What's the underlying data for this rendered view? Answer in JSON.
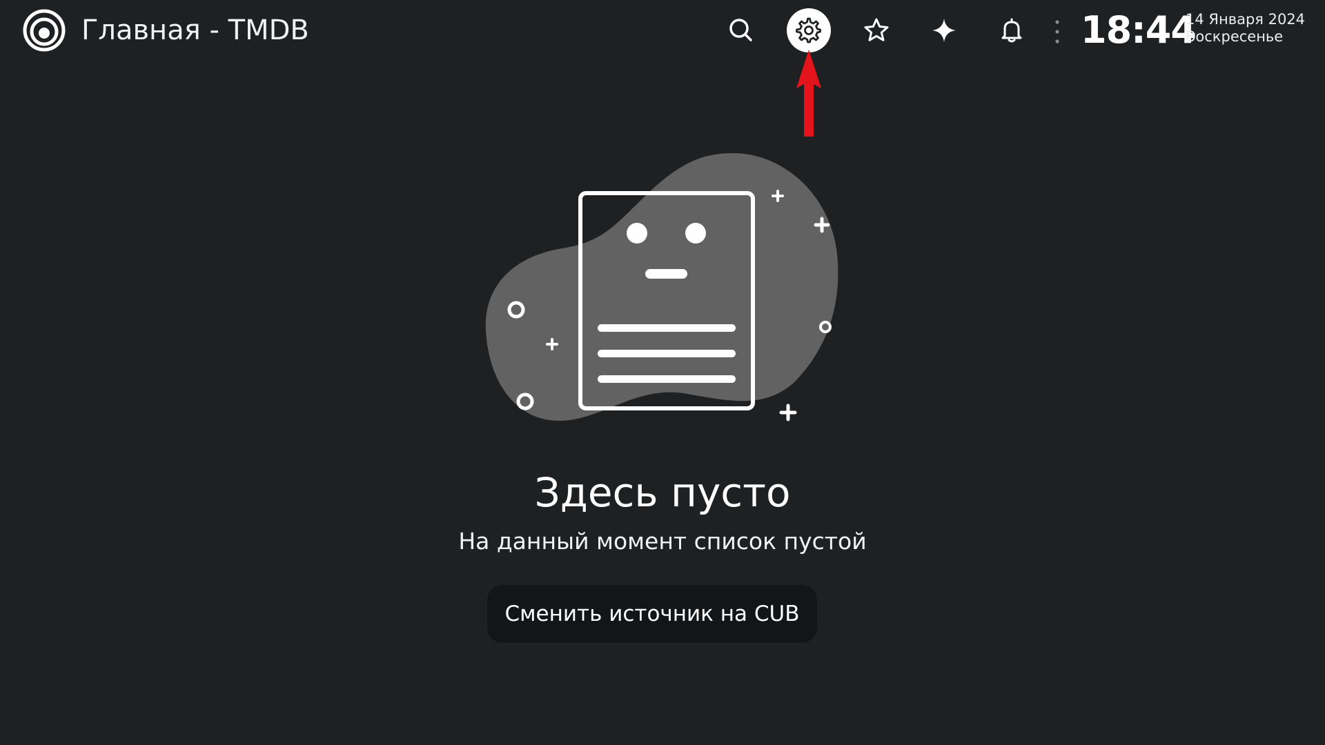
{
  "header": {
    "title": "Главная - TMDB",
    "icons": {
      "logo": "app-logo",
      "search": "search-icon",
      "settings": "gear-icon",
      "bookmarks": "star-icon",
      "feed": "sparkle-icon",
      "notifications": "bell-icon",
      "more": "dots-vertical-icon"
    },
    "time": "18:44",
    "date": "14 Января 2024",
    "weekday": "Воскресенье"
  },
  "empty_state": {
    "title": "Здесь пусто",
    "subtitle": "На данный момент список пустой",
    "button_label": "Сменить источник на CUB"
  },
  "colors": {
    "background": "#1f2022",
    "blob": "#616261",
    "button_bg": "#141516",
    "arrow": "#e3141b",
    "text": "#ffffff"
  }
}
